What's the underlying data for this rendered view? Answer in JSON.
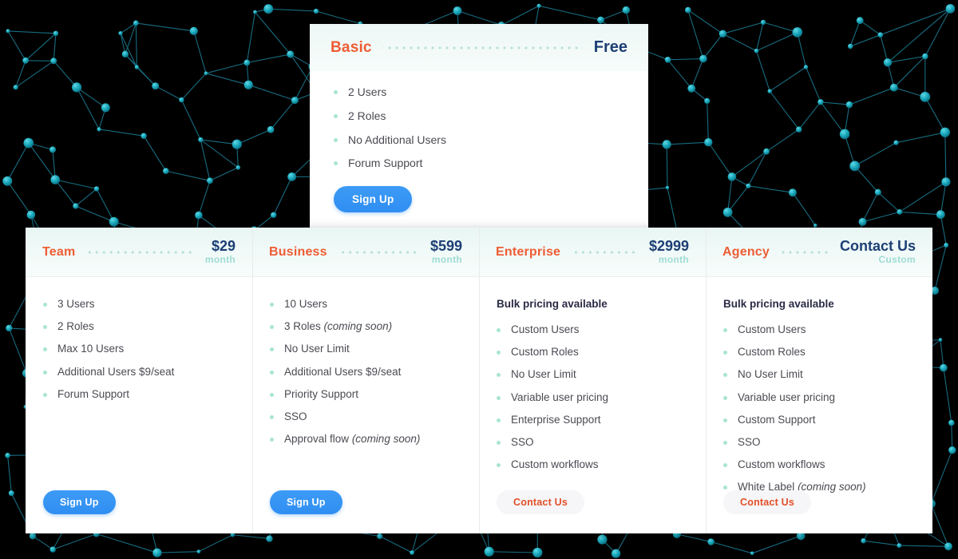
{
  "background": {
    "name": "network-graph-background",
    "base_color": "#000000",
    "node_color": "#1aa7b8",
    "edge_color": "#1b7f98"
  },
  "featured_plan": {
    "name": "Basic",
    "price": "Free",
    "price_unit": "",
    "features": [
      {
        "text": "2 Users",
        "note": ""
      },
      {
        "text": "2 Roles",
        "note": ""
      },
      {
        "text": "No Additional Users",
        "note": ""
      },
      {
        "text": "Forum Support",
        "note": ""
      }
    ],
    "cta": {
      "label": "Sign Up",
      "style": "primary"
    }
  },
  "plans": [
    {
      "name": "Team",
      "price": "$29",
      "price_unit": "month",
      "bulk_note": "",
      "features": [
        {
          "text": "3 Users",
          "note": ""
        },
        {
          "text": "2 Roles",
          "note": ""
        },
        {
          "text": "Max 10 Users",
          "note": ""
        },
        {
          "text": "Additional Users $9/seat",
          "note": ""
        },
        {
          "text": "Forum Support",
          "note": ""
        }
      ],
      "cta": {
        "label": "Sign Up",
        "style": "primary"
      }
    },
    {
      "name": "Business",
      "price": "$599",
      "price_unit": "month",
      "bulk_note": "",
      "features": [
        {
          "text": "10 Users",
          "note": ""
        },
        {
          "text": "3 Roles",
          "note": "(coming soon)"
        },
        {
          "text": "No User Limit",
          "note": ""
        },
        {
          "text": "Additional Users $9/seat",
          "note": ""
        },
        {
          "text": "Priority Support",
          "note": ""
        },
        {
          "text": "SSO",
          "note": ""
        },
        {
          "text": "Approval flow",
          "note": "(coming soon)"
        }
      ],
      "cta": {
        "label": "Sign Up",
        "style": "primary"
      }
    },
    {
      "name": "Enterprise",
      "price": "$2999",
      "price_unit": "month",
      "bulk_note": "Bulk pricing available",
      "features": [
        {
          "text": "Custom Users",
          "note": ""
        },
        {
          "text": "Custom Roles",
          "note": ""
        },
        {
          "text": "No User Limit",
          "note": ""
        },
        {
          "text": "Variable user pricing",
          "note": ""
        },
        {
          "text": "Enterprise Support",
          "note": ""
        },
        {
          "text": "SSO",
          "note": ""
        },
        {
          "text": "Custom workflows",
          "note": ""
        }
      ],
      "cta": {
        "label": "Contact Us",
        "style": "ghost"
      }
    },
    {
      "name": "Agency",
      "price": "Contact Us",
      "price_unit": "Custom",
      "bulk_note": "Bulk pricing available",
      "features": [
        {
          "text": "Custom Users",
          "note": ""
        },
        {
          "text": "Custom Roles",
          "note": ""
        },
        {
          "text": "No User Limit",
          "note": ""
        },
        {
          "text": "Variable user pricing",
          "note": ""
        },
        {
          "text": "Custom Support",
          "note": ""
        },
        {
          "text": "SSO",
          "note": ""
        },
        {
          "text": "Custom workflows",
          "note": ""
        },
        {
          "text": "White Label",
          "note": "(coming soon)"
        }
      ],
      "cta": {
        "label": "Contact Us",
        "style": "ghost"
      }
    }
  ],
  "colors": {
    "plan_name": "#ee5c33",
    "price": "#1d3f75",
    "price_unit": "#9fdcd3",
    "bullet": "#a9e4d4",
    "primary_button": "#2f8ef2",
    "ghost_button_text": "#e2502a",
    "header_tint": "#edf8f6"
  }
}
